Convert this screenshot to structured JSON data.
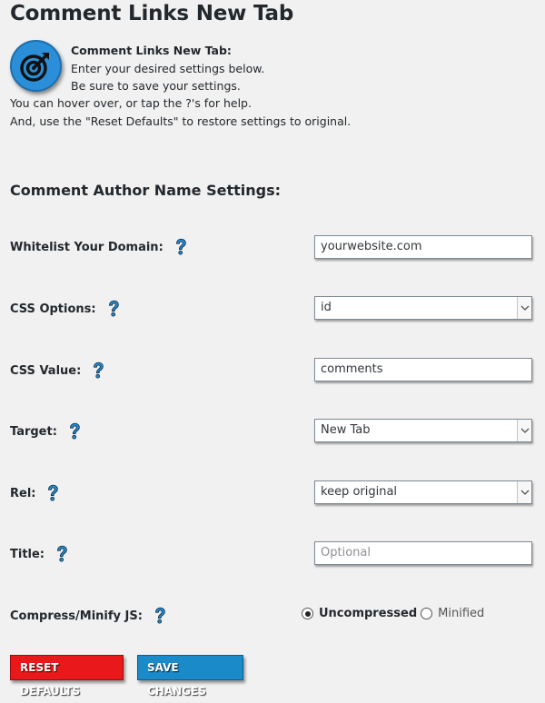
{
  "page": {
    "title": "Comment Links New Tab"
  },
  "intro": {
    "title": "Comment Links New Tab:",
    "line1": "Enter your desired settings below.",
    "line2": "Be sure to save your settings.",
    "line3": "You can hover over, or tap the ?'s for help.",
    "line4": "And, use the \"Reset Defaults\" to restore settings to original."
  },
  "section": {
    "title": "Comment Author Name Settings:"
  },
  "fields": {
    "whitelist": {
      "label": "Whitelist Your Domain:",
      "value": "yourwebsite.com"
    },
    "css_options": {
      "label": "CSS Options:",
      "value": "id"
    },
    "css_value": {
      "label": "CSS Value:",
      "value": "comments"
    },
    "target": {
      "label": "Target:",
      "value": "New Tab"
    },
    "rel": {
      "label": "Rel:",
      "value": "keep original"
    },
    "title": {
      "label": "Title:",
      "value": "",
      "placeholder": "Optional"
    },
    "compress": {
      "label": "Compress/Minify JS:",
      "option_selected": "Uncompressed",
      "option_other": "Minified"
    }
  },
  "buttons": {
    "reset": "RESET DEFAULTS",
    "save": "SAVE CHANGES"
  },
  "colors": {
    "accent_blue": "#1b8ac9",
    "reset_red": "#e8181b",
    "help_icon": "#2a8fd8"
  },
  "icons": {
    "logo": "target-icon",
    "help": "help-question-icon",
    "select": "chevron-down-icon"
  }
}
